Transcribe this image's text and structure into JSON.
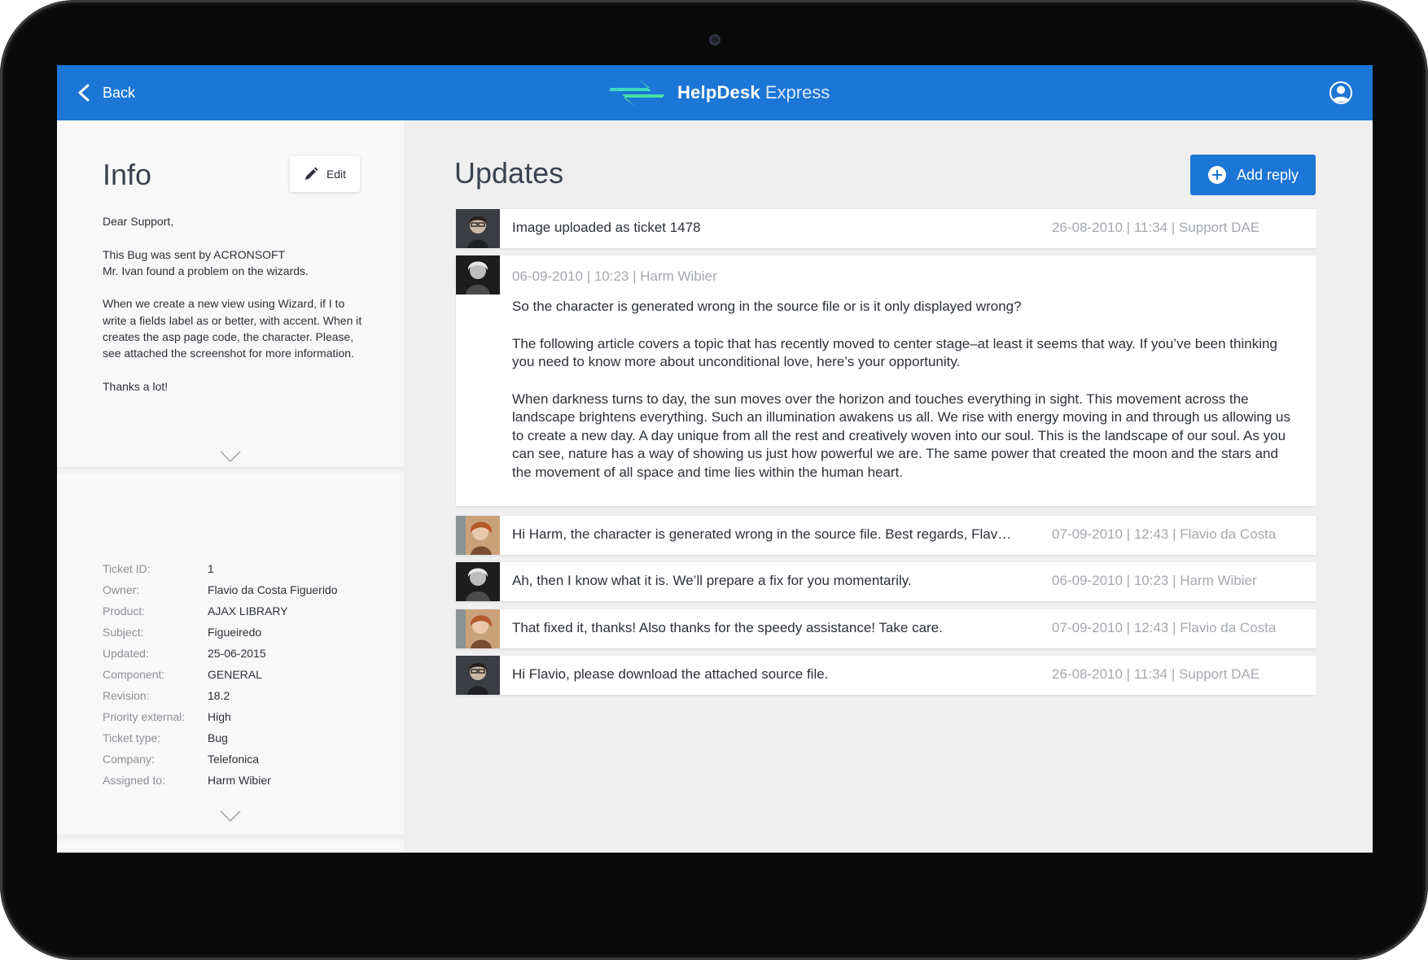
{
  "header": {
    "back_label": "Back",
    "brand_name": "HelpDesk",
    "brand_sub": "Express",
    "accent": "#1b76d5"
  },
  "info": {
    "title": "Info",
    "edit_label": "Edit",
    "paragraphs": [
      "Dear Support,",
      "This Bug was sent by ACRONSOFT\nMr. Ivan found a problem on the wizards.",
      "When we create a new view using Wizard, if I to write a fields label as or better, with accent. When it creates the asp page code, the character. Please, see attached the screenshot for more information.",
      "Thanks a lot!"
    ]
  },
  "details": [
    {
      "k": "Ticket ID:",
      "v": "1"
    },
    {
      "k": "Owner:",
      "v": "Flavio da Costa Figuerido"
    },
    {
      "k": "Product:",
      "v": "AJAX LIBRARY"
    },
    {
      "k": "Subject:",
      "v": "Figueiredo"
    },
    {
      "k": "Updated:",
      "v": "25-06-2015"
    },
    {
      "k": "Component:",
      "v": "GENERAL"
    },
    {
      "k": "Revision:",
      "v": "18.2"
    },
    {
      "k": "Priority external:",
      "v": "High"
    },
    {
      "k": "Ticket type:",
      "v": "Bug"
    },
    {
      "k": "Company:",
      "v": "Telefonica"
    },
    {
      "k": "Assigned to:",
      "v": "Harm Wibier"
    }
  ],
  "updates": {
    "title": "Updates",
    "add_reply_label": "Add reply",
    "items": [
      {
        "msg": "Image uploaded as ticket 1478",
        "meta": "26-08-2010 | 11:34 | Support DAE",
        "avatar": "avatar-support"
      },
      {
        "meta": "06-09-2010 | 10:23 | Harm Wibier",
        "avatar": "avatar-harm",
        "body": [
          "So the character is generated wrong in the source file or is it only displayed wrong?",
          "The following article covers a topic that has recently moved to center stage–at least it seems that way. If you’ve been thinking you need to know more about unconditional love, here’s your opportunity.",
          "When darkness turns to day, the sun moves over the horizon and touches everything in sight. This movement across the landscape brightens everything. Such an illumination awakens us all. We rise with energy moving in and through us allowing us to create a new day. A day unique from all the rest and creatively woven into our soul.  This is the landscape of our soul. As you can see, nature has a way of showing us just how powerful we are. The same power that created the moon and the stars and the movement of all space and time lies within the human heart."
        ]
      },
      {
        "msg": "Hi Harm, the character is generated wrong in the source file. Best regards, Flav…",
        "meta": "07-09-2010 | 12:43 | Flavio da Costa",
        "avatar": "avatar-flavio"
      },
      {
        "msg": "Ah, then I know what it is. We’ll prepare a fix for you momentarily.",
        "meta": "06-09-2010 | 10:23 | Harm Wibier",
        "avatar": "avatar-harm"
      },
      {
        "msg": "That fixed it, thanks! Also thanks for the speedy assistance! Take care.",
        "meta": "07-09-2010 | 12:43 | Flavio da Costa",
        "avatar": "avatar-flavio"
      },
      {
        "msg": "Hi Flavio, please download the attached source file.",
        "meta": "26-08-2010 | 11:34 | Support DAE",
        "avatar": "avatar-support"
      }
    ]
  }
}
